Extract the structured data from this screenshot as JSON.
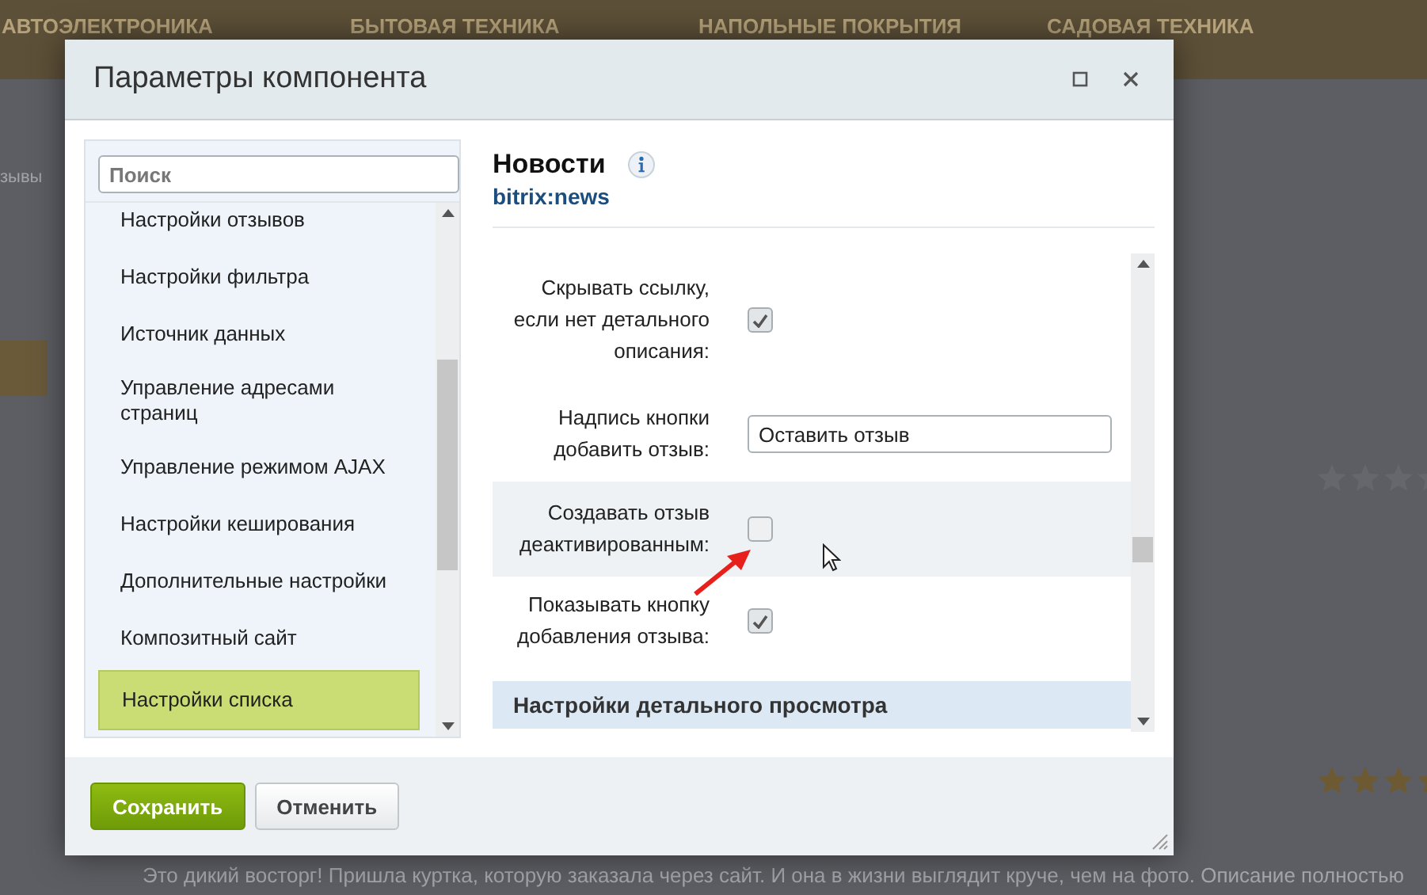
{
  "background_page": {
    "nav_items": [
      "АВТОЭЛЕКТРОНИКА",
      "БЫТОВАЯ ТЕХНИКА",
      "НАПОЛЬНЫЕ ПОКРЫТИЯ",
      "САДОВАЯ ТЕХНИКА"
    ],
    "breadcrumb": "зывы",
    "review_text": "Это дикий восторг! Пришла куртка, которую заказала через сайт. И она в жизни выглядит круче, чем на фото. Описание полностью"
  },
  "dialog": {
    "title": "Параметры компонента",
    "search": {
      "placeholder": "Поиск"
    },
    "sections": [
      {
        "label": "Настройки отзывов",
        "selected": false
      },
      {
        "label": "Настройки фильтра",
        "selected": false
      },
      {
        "label": "Источник данных",
        "selected": false
      },
      {
        "label": "Управление адресами страниц",
        "selected": false
      },
      {
        "label": "Управление режимом AJAX",
        "selected": false
      },
      {
        "label": "Настройки кеширования",
        "selected": false
      },
      {
        "label": "Дополнительные настройки",
        "selected": false
      },
      {
        "label": "Композитный сайт",
        "selected": false
      },
      {
        "label": "Настройки списка",
        "selected": true
      }
    ],
    "component": {
      "name": "Новости",
      "code": "bitrix:news"
    },
    "params": [
      {
        "kind": "checkbox",
        "label": "Скрывать ссылку, если нет детального описания:",
        "checked": true,
        "hovered": false
      },
      {
        "kind": "text",
        "label": "Надпись кнопки добавить отзыв:",
        "value": "Оставить отзыв",
        "hovered": false
      },
      {
        "kind": "checkbox",
        "label": "Создавать отзыв деактивированным:",
        "checked": false,
        "hovered": true
      },
      {
        "kind": "checkbox",
        "label": "Показывать кнопку добавления отзыва:",
        "checked": true,
        "hovered": false
      },
      {
        "kind": "section",
        "label": "Настройки детального просмотра"
      }
    ],
    "buttons": [
      {
        "label": "Сохранить",
        "kind": "primary"
      },
      {
        "label": "Отменить",
        "kind": "secondary"
      }
    ]
  }
}
